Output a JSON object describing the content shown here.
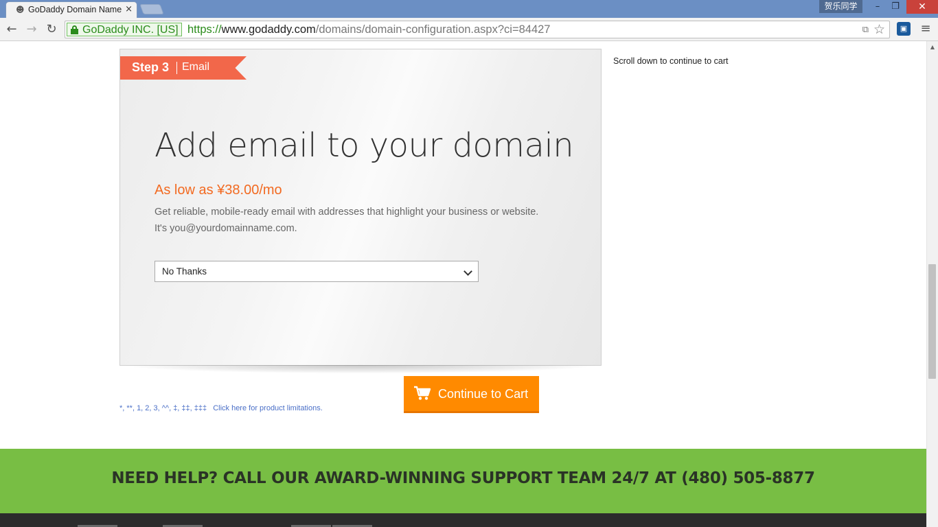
{
  "browser": {
    "tab_title": "GoDaddy Domain Name",
    "tab_close": "×",
    "user_badge": "贺乐同学",
    "win_min": "–",
    "win_max": "❐",
    "win_close": "✕",
    "ev_org": "GoDaddy INC. [US]",
    "url_scheme": "https://",
    "url_host": "www.godaddy.com",
    "url_path": "/domains/domain-configuration.aspx?ci=84427",
    "back_icon": "←",
    "forward_icon": "→",
    "reload_icon": "↻",
    "star_icon": "☆",
    "menu_icon": "≡"
  },
  "step": {
    "number": "Step 3",
    "name": "Email"
  },
  "email_offer": {
    "headline": "Add email to your domain",
    "price": "As low as ¥38.00/mo",
    "description_line1": "Get reliable, mobile-ready email with addresses that highlight your business or website.",
    "description_line2": "It's you@yourdomainname.com.",
    "select_value": "No Thanks"
  },
  "sidebar": {
    "scroll_note": "Scroll down to continue to cart"
  },
  "cart": {
    "button_label": "Continue to Cart"
  },
  "limitations": {
    "symbols": "*, **, 1, 2, 3, ^^, ‡, ‡‡, ‡‡‡",
    "link_text": "Click here for product limitations."
  },
  "help": {
    "text": "NEED HELP? CALL OUR AWARD-WINNING SUPPORT TEAM 24/7 AT (480) 505-8877"
  },
  "colors": {
    "accent_orange": "#f26a21",
    "step_banner": "#f2674a",
    "cart_button": "#ff8a00",
    "help_band": "#78be44",
    "link_blue": "#4a6fc7"
  }
}
